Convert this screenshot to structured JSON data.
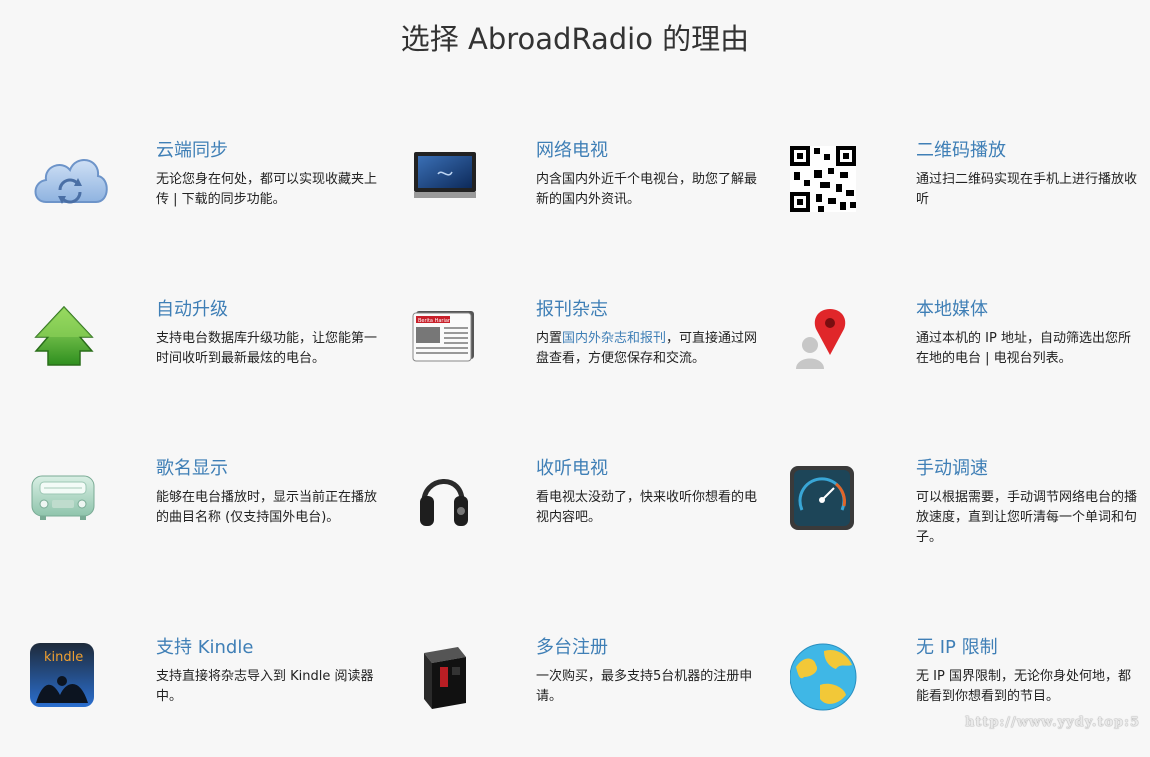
{
  "page": {
    "title": "选择 AbroadRadio 的理由"
  },
  "features": [
    {
      "title": "云端同步",
      "desc": "无论您身在何处，都可以实现收藏夹上传 | 下载的同步功能。",
      "icon": "cloud-sync-icon"
    },
    {
      "title": "网络电视",
      "desc": "内含国内外近千个电视台，助您了解最新的国内外资讯。",
      "icon": "tv-icon"
    },
    {
      "title": "二维码播放",
      "desc": "通过扫二维码实现在手机上进行播放收听",
      "icon": "qr-code-icon"
    },
    {
      "title": "自动升级",
      "desc": "支持电台数据库升级功能，让您能第一时间收听到最新最炫的电台。",
      "icon": "upgrade-arrow-icon"
    },
    {
      "title": "报刊杂志",
      "desc_pre": "内置",
      "desc_link": "国内外杂志和报刊",
      "desc_post": "，可直接通过网盘查看，方便您保存和交流。",
      "icon": "newspaper-icon",
      "badge": "Berita Harian"
    },
    {
      "title": "本地媒体",
      "desc": "通过本机的 IP 地址，自动筛选出您所在地的电台 | 电视台列表。",
      "icon": "location-pin-icon"
    },
    {
      "title": "歌名显示",
      "desc": "能够在电台播放时，显示当前正在播放的曲目名称 (仅支持国外电台)。",
      "icon": "radio-icon"
    },
    {
      "title": "收听电视",
      "desc": "看电视太没劲了，快来收听你想看的电视内容吧。",
      "icon": "headphones-icon"
    },
    {
      "title": "手动调速",
      "desc": "可以根据需要，手动调节网络电台的播放速度，直到让您听清每一个单词和句子。",
      "icon": "speedometer-icon"
    },
    {
      "title": "支持 Kindle",
      "desc": "支持直接将杂志导入到 Kindle 阅读器中。",
      "icon": "kindle-icon",
      "badge": "kindle"
    },
    {
      "title": "多台注册",
      "desc": "一次购买，最多支持5台机器的注册申请。",
      "icon": "computer-case-icon"
    },
    {
      "title": "无 IP 限制",
      "desc": "无 IP 国界限制，无论你身处何地，都能看到你想看到的节目。",
      "icon": "globe-icon"
    }
  ],
  "watermark": "http://www.yydy.top:5",
  "colors": {
    "link": "#3f7fb6",
    "text": "#222222",
    "background": "#f7f7f7"
  }
}
